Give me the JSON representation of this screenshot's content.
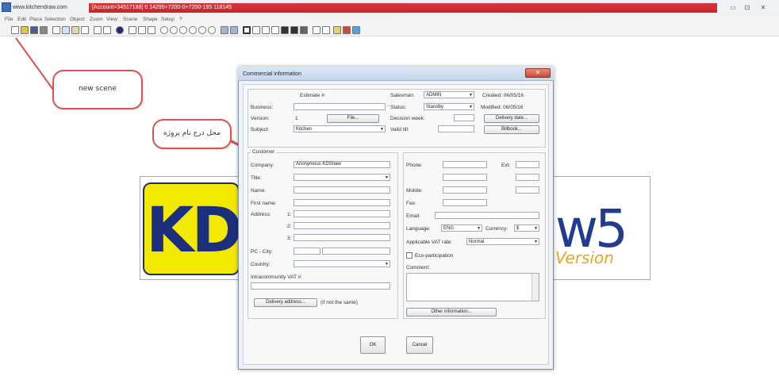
{
  "window": {
    "url": "www.kitchendraw.com",
    "account": "[Account=34517188] 0 14295+7200-0+7200-195 118145",
    "minimize_glyph": "▭",
    "restore_glyph": "⊡",
    "close_glyph": "✕"
  },
  "menu": [
    "File",
    "Edit",
    "Place",
    "Selection",
    "Object",
    "Zoom",
    "View",
    "Scene",
    "Shape",
    "Setup",
    "?"
  ],
  "callouts": {
    "new_scene": "new scene",
    "project_name": "محل درج نام پروژه"
  },
  "logo": {
    "kd": "KD",
    "w5": "w5",
    "version": "Version"
  },
  "dialog": {
    "title": "Commercial information",
    "close_glyph": "✕",
    "estimate_label": "Estimate #:",
    "business_label": "Business:",
    "version_label": "Version:",
    "version_value": "1",
    "file_button": "File...",
    "subject_label": "Subject:",
    "subject_value": "Kitchen",
    "salesman_label": "Salesman:",
    "salesman_value": "ADMIN",
    "status_label": "Status:",
    "status_value": "Standby",
    "decision_week_label": "Decision week:",
    "valid_label": "Valid till:",
    "created_label": "Created: 06/05/16",
    "modified_label": "Modified: 06/05/16",
    "delivery_date_button": "Delivery date...",
    "billbook_button": "Billbook...",
    "customer_label": "Customer",
    "company_label": "Company:",
    "company_value": "Anonymous KDShaw",
    "title_label": "Title:",
    "name_label": "Name:",
    "first_name_label": "First name:",
    "address_label": "Address:",
    "address_lines": [
      "1:",
      "2:",
      "3:"
    ],
    "pc_city_label": "PC - City:",
    "country_label": "Country:",
    "intra_vat_label": "Intracommunity VAT #:",
    "delivery_address_button": "Delivery address...",
    "if_not_same": "(if not the same)",
    "phone_label": "Phone:",
    "ext_label": "Ext:",
    "mobile_label": "Mobile:",
    "fax_label": "Fax:",
    "email_label": "Email:",
    "language_label": "Language:",
    "language_value": "ENG",
    "currency_label": "Currency:",
    "currency_value": "$",
    "vat_label": "Applicable VAT rate:",
    "vat_value": "Normal",
    "eco_label": "Eco-participation",
    "comment_label": "Comment:",
    "other_info_button": "Other information...",
    "ok_button": "OK",
    "cancel_button": "Cancel"
  }
}
